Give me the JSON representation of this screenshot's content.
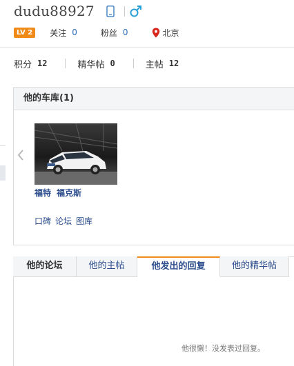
{
  "profile": {
    "username": "dudu88927",
    "level": "LV 2",
    "follow_label": "关注",
    "follow_count": "0",
    "fans_label": "粉丝",
    "fans_count": "0",
    "location": "北京"
  },
  "stats": {
    "points_label": "积分",
    "points": "12",
    "featured_label": "精华帖",
    "featured": "0",
    "threads_label": "主帖",
    "threads": "12"
  },
  "garage": {
    "title": "他的车库(1)",
    "car": {
      "brand": "福特",
      "model": "福克斯",
      "links": [
        "口碑",
        "论坛",
        "图库"
      ]
    }
  },
  "forum": {
    "title": "他的论坛",
    "tabs": [
      "他的主帖",
      "他发出的回复",
      "他的精华帖"
    ],
    "active_tab": "他发出的回复",
    "empty_message": "他很懒！没发表过回复。"
  },
  "colors": {
    "accent_orange": "#f08a19",
    "link_blue": "#2b4c8c",
    "icon_blue": "#27a0d8",
    "pin_red": "#d9261c"
  }
}
